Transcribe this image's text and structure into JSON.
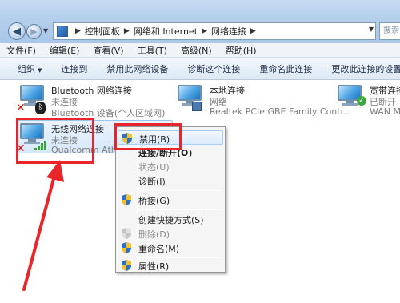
{
  "breadcrumb": {
    "items": [
      "控制面板",
      "网络和 Internet",
      "网络连接"
    ],
    "search_placeholder": "搜索"
  },
  "menubar": {
    "items": [
      "文件(F)",
      "编辑(E)",
      "查看(V)",
      "工具(T)",
      "高级(N)",
      "帮助(H)"
    ]
  },
  "commandbar": {
    "organize": "组织",
    "items": [
      "连接到",
      "禁用此网络设备",
      "诊断这个连接",
      "重命名此连接",
      "更改此连接的设置"
    ]
  },
  "connections": {
    "bluetooth": {
      "name": "Bluetooth 网络连接",
      "status": "未连接",
      "device": "Bluetooth 设备(个人区域网)"
    },
    "local": {
      "name": "本地连接",
      "status": "网络",
      "device": "Realtek PCIe GBE Family Contr..."
    },
    "broadband": {
      "name": "宽带连接",
      "status": "已断开",
      "device": "WAN Mi"
    },
    "wireless": {
      "name": "无线网络连接",
      "status": "未连接",
      "device": "Qualcomm Atheros"
    }
  },
  "context_menu": {
    "disable": "禁用(B)",
    "connect": "连接/断开(O)",
    "status": "状态(U)",
    "diagnose": "诊断(I)",
    "bridge": "桥接(G)",
    "shortcut": "创建快捷方式(S)",
    "delete": "删除(D)",
    "rename": "重命名(M)",
    "properties": "属性(R)"
  },
  "colors": {
    "annotation_red": "#e8252a",
    "shield_blue": "#2f6fc4",
    "shield_yellow": "#f3c12c"
  },
  "icons": [
    "back-icon",
    "forward-icon",
    "refresh-icon",
    "shield-icon",
    "bluetooth-icon",
    "signal-icon",
    "disconnected-icon"
  ]
}
